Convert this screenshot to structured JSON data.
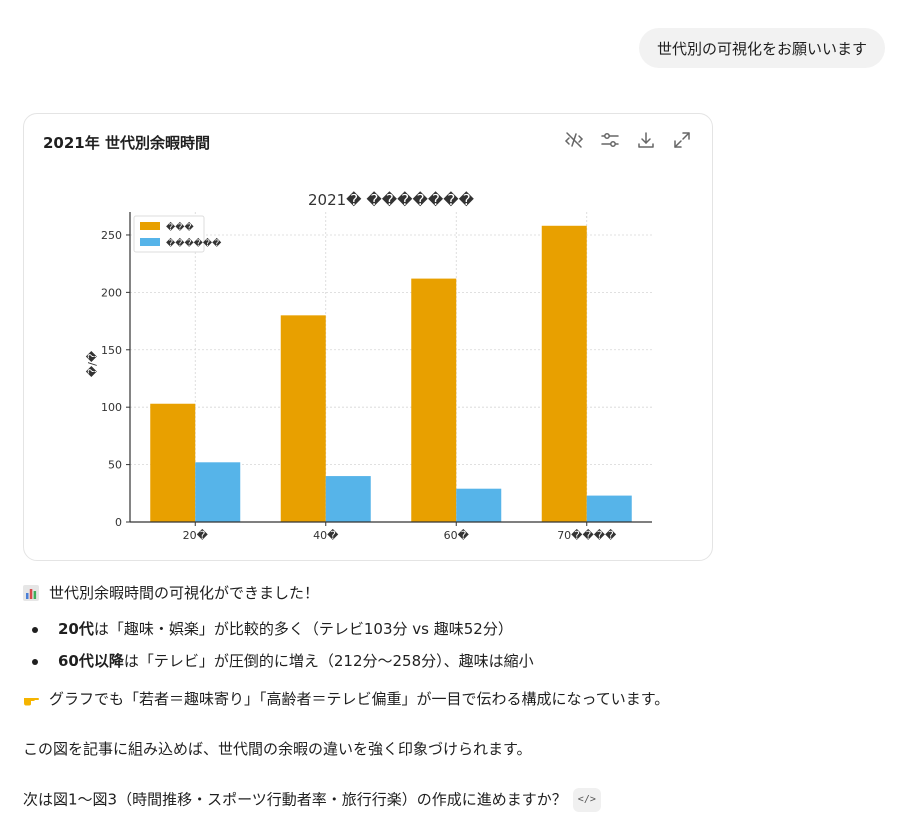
{
  "user_message": "世代別の可視化をお願いいます",
  "card": {
    "title": "2021年 世代別余暇時間",
    "tools": [
      "hide-code-icon",
      "settings-sliders-icon",
      "download-icon",
      "expand-icon"
    ]
  },
  "chart_data": {
    "type": "bar",
    "title": "2021�  �������",
    "ylabel": "�/�",
    "categories": [
      "20�",
      "40�",
      "60�",
      "70����"
    ],
    "series": [
      {
        "name": "���",
        "color": "#E8A000",
        "values": [
          103,
          180,
          212,
          258
        ]
      },
      {
        "name": "������",
        "color": "#56B4E9",
        "values": [
          52,
          40,
          29,
          23
        ]
      }
    ],
    "ylim": [
      0,
      270
    ],
    "yticks": [
      0,
      50,
      100,
      150,
      200,
      250
    ],
    "grid": true,
    "legend": "top-left"
  },
  "reply": {
    "intro": "世代別余暇時間の可視化ができました！",
    "bullets": [
      {
        "bold": "20代",
        "text": "は「趣味・娯楽」が比較的多く（テレビ103分 vs 趣味52分）"
      },
      {
        "bold": "60代以降",
        "text": "は「テレビ」が圧倒的に増え（212分〜258分）、趣味は縮小"
      }
    ],
    "point": "グラフでも「若者＝趣味寄り」「高齢者＝テレビ偏重」が一目で伝わる構成になっています。",
    "line2": "この図を記事に組み込めば、世代間の余暇の違いを強く印象づけられます。",
    "question": "次は図1〜図3（時間推移・スポーツ行動者率・旅行行楽）の作成に進めますか？",
    "code_badge": "</>"
  }
}
